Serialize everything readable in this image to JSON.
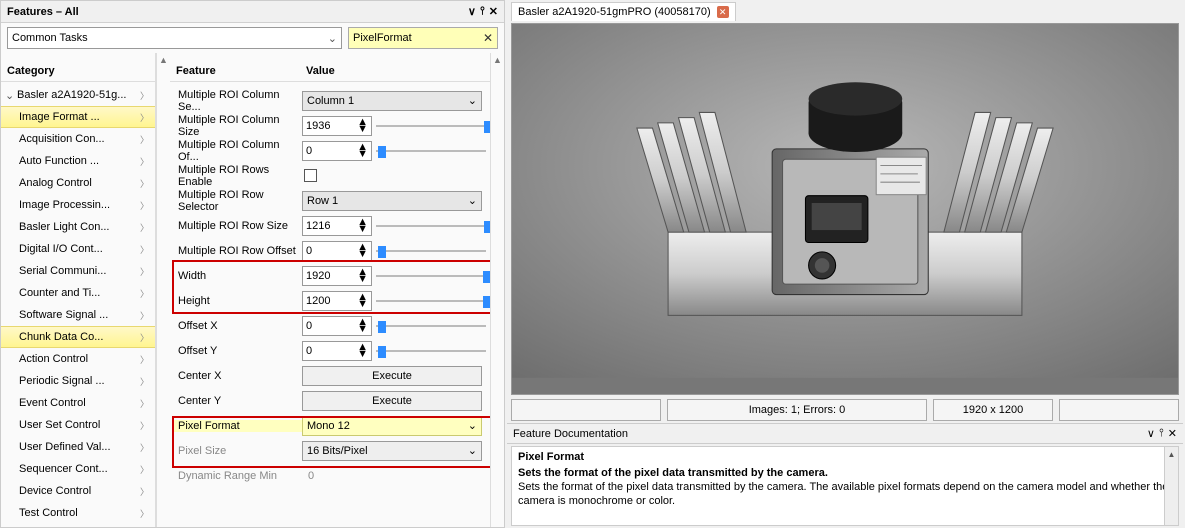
{
  "features_panel": {
    "title": "Features – All",
    "dropdown": "Common Tasks",
    "search_value": "PixelFormat"
  },
  "category": {
    "header": "Category",
    "items": [
      {
        "label": "Basler a2A1920-51g...",
        "top": true
      },
      {
        "label": "Image Format ...",
        "sel": true
      },
      {
        "label": "Acquisition Con..."
      },
      {
        "label": "Auto Function ..."
      },
      {
        "label": "Analog Control"
      },
      {
        "label": "Image Processin..."
      },
      {
        "label": "Basler Light Con..."
      },
      {
        "label": "Digital I/O Cont..."
      },
      {
        "label": "Serial Communi..."
      },
      {
        "label": "Counter and Ti..."
      },
      {
        "label": "Software Signal ..."
      },
      {
        "label": "Chunk Data Co...",
        "sel": true
      },
      {
        "label": "Action Control"
      },
      {
        "label": "Periodic Signal ..."
      },
      {
        "label": "Event Control"
      },
      {
        "label": "User Set Control"
      },
      {
        "label": "User Defined Val..."
      },
      {
        "label": "Sequencer Cont..."
      },
      {
        "label": "Device Control"
      },
      {
        "label": "Test Control"
      }
    ]
  },
  "feature_headers": {
    "feature": "Feature",
    "value": "Value"
  },
  "features": [
    {
      "name": "Multiple ROI Column Se...",
      "type": "select",
      "value": "Column 1"
    },
    {
      "name": "Multiple ROI Column Size",
      "type": "spin",
      "value": "1936",
      "thumb": 98
    },
    {
      "name": "Multiple ROI Column Of...",
      "type": "spin",
      "value": "0",
      "thumb": 2
    },
    {
      "name": "Multiple ROI Rows Enable",
      "type": "check"
    },
    {
      "name": "Multiple ROI Row Selector",
      "type": "select",
      "value": "Row 1"
    },
    {
      "name": "Multiple ROI Row Size",
      "type": "spin",
      "value": "1216",
      "thumb": 98
    },
    {
      "name": "Multiple ROI Row Offset",
      "type": "spin",
      "value": "0",
      "thumb": 2
    },
    {
      "name": "Width",
      "type": "spin",
      "value": "1920",
      "thumb": 97
    },
    {
      "name": "Height",
      "type": "spin",
      "value": "1200",
      "thumb": 97
    },
    {
      "name": "Offset X",
      "type": "spin",
      "value": "0",
      "thumb": 2
    },
    {
      "name": "Offset Y",
      "type": "spin",
      "value": "0",
      "thumb": 2
    },
    {
      "name": "Center X",
      "type": "exec",
      "value": "Execute"
    },
    {
      "name": "Center Y",
      "type": "exec",
      "value": "Execute"
    },
    {
      "name": "Pixel Format",
      "type": "select",
      "value": "Mono 12",
      "hl": true,
      "namehl": true
    },
    {
      "name": "Pixel Size",
      "type": "readonly",
      "value": "16 Bits/Pixel"
    },
    {
      "name": "Dynamic Range Min",
      "type": "readonly_plain",
      "value": "0"
    }
  ],
  "preview": {
    "tab": "Basler a2A1920-51gmPRO (40058170)",
    "status1": "Images: 1; Errors: 0",
    "status2": "1920 x 1200"
  },
  "doc": {
    "panel_title": "Feature Documentation",
    "heading": "Pixel Format",
    "lead": "Sets the format of the pixel data transmitted by the camera.",
    "body": "Sets the format of the pixel data transmitted by the camera. The available pixel formats depend on the camera model and whether the camera is monochrome or color."
  }
}
